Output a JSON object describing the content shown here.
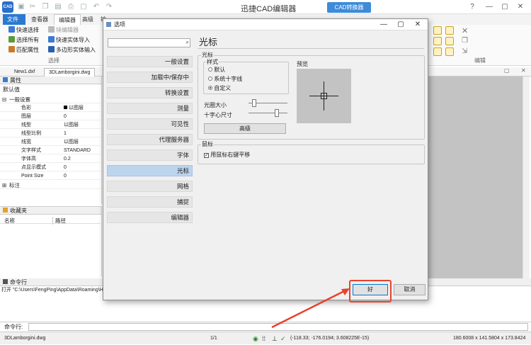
{
  "app": {
    "logo": "CAD",
    "title": "迅捷CAD编辑器",
    "converter_label": "CAD转换器"
  },
  "ribbon_tabs": [
    "文件",
    "查看器",
    "编辑器",
    "高级",
    "输"
  ],
  "ribbon": {
    "items": [
      {
        "label": "快速选择",
        "icon": "quick-select-icon"
      },
      {
        "label": "选择所有",
        "icon": "select-all-icon"
      },
      {
        "label": "匹配属性",
        "icon": "match-properties-icon"
      },
      {
        "label": "块编辑器",
        "icon": "block-editor-icon"
      },
      {
        "label": "快速实体导入",
        "icon": "entity-import-icon"
      },
      {
        "label": "多边形实体输入",
        "icon": "polygon-entity-icon"
      }
    ],
    "group_select": "选择",
    "group_edit": "编辑"
  },
  "doc_tabs": [
    "New1.dxf",
    "3DLamborgini.dwg"
  ],
  "properties": {
    "header": "属性",
    "default_value": "默认值",
    "general_section": "一般设置",
    "rows": [
      {
        "key": "色彩",
        "value": "以图层"
      },
      {
        "key": "图层",
        "value": "0"
      },
      {
        "key": "线型",
        "value": "以图层"
      },
      {
        "key": "线型比例",
        "value": "1"
      },
      {
        "key": "线宽",
        "value": "以图层"
      },
      {
        "key": "文字样式",
        "value": "STANDARD"
      },
      {
        "key": "字体高",
        "value": "0.2"
      },
      {
        "key": "点显示模式",
        "value": "0"
      },
      {
        "key": "Point Size",
        "value": "0"
      }
    ],
    "annotation_section": "标注"
  },
  "favorites": {
    "header": "收藏夹",
    "col_name": "名称",
    "col_path": "路径"
  },
  "command": {
    "header": "命令行",
    "output": "打开 \"C:\\Users\\FengPing\\AppData\\Roaming\\Hi",
    "prompt": "命令行:"
  },
  "status": {
    "file": "3DLamborgini.dwg",
    "page": "1/1",
    "coords": "(-118.33; -176.0194; 3.608225E-15)",
    "size": "180.6008 x 141.5804 x 173.8424"
  },
  "dialog": {
    "title": "选项",
    "nav": [
      "一般设置",
      "加载中/保存中",
      "转换设置",
      "测量",
      "可见性",
      "代理服务器",
      "字体",
      "光标",
      "网格",
      "捕捉",
      "编辑器"
    ],
    "selected_nav": "光标",
    "page_title": "光标",
    "cursor_group": "光标",
    "style_group": "样式",
    "style_options": [
      "默认",
      "系统十字线",
      "自定义"
    ],
    "style_selected": 2,
    "preview_label": "预览",
    "cursor_size_label": "光圈大小",
    "crosshair_size_label": "十字心尺寸",
    "cursor_size_level": 0.1,
    "crosshair_size_level": 0.75,
    "advanced_button": "高级",
    "mouse_group": "鼠标",
    "pan_checkbox": "用鼠标右键平移",
    "pan_checked": true,
    "ok_button": "好",
    "cancel_button": "取消"
  },
  "colors": {
    "accent_blue": "#2b79d0",
    "annotation_red": "#e8432e",
    "selected_nav": "#bcd4ee",
    "canvas_gray": "#c3c3c3"
  }
}
